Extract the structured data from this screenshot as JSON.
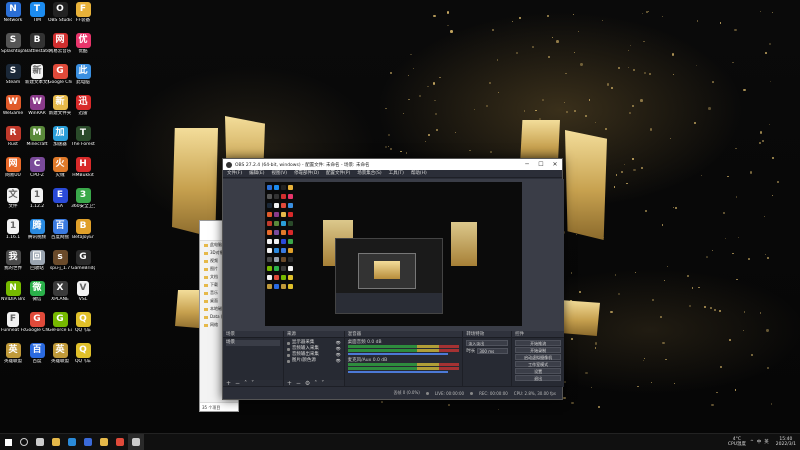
{
  "desktop": {
    "icons": [
      {
        "label": "Network",
        "icon": "network-icon",
        "color": "#2b6fd6"
      },
      {
        "label": "TIM",
        "icon": "tim-icon",
        "color": "#1c8cf0"
      },
      {
        "label": "OBS Studio",
        "icon": "obs-icon",
        "color": "#222222"
      },
      {
        "label": "FF装备",
        "icon": "ff-icon",
        "color": "#e8b23a"
      },
      {
        "label": "SplashtopStreamer",
        "icon": "splashtop-icon",
        "color": "#555555"
      },
      {
        "label": "Battlestate Games L...",
        "icon": "battlestate-icon",
        "color": "#333333"
      },
      {
        "label": "网易云音乐",
        "icon": "netease-icon",
        "color": "#d12f2f"
      },
      {
        "label": "优酷",
        "icon": "youku-icon",
        "color": "#e8356b"
      },
      {
        "label": "Steam",
        "icon": "steam-icon",
        "color": "#1b2838"
      },
      {
        "label": "新建文本文档",
        "icon": "text-file-icon",
        "color": "#f2f2f2"
      },
      {
        "label": "Google Chrome",
        "icon": "chrome-icon",
        "color": "#e04a3a"
      },
      {
        "label": "此电脑",
        "icon": "computer-icon",
        "color": "#3a8fe0"
      },
      {
        "label": "WeGame",
        "icon": "wegame-icon",
        "color": "#e05a2a"
      },
      {
        "label": "WinRAR",
        "icon": "winrar-icon",
        "color": "#8a3a8a"
      },
      {
        "label": "新建文件夹",
        "icon": "folder-icon",
        "color": "#e6b94a"
      },
      {
        "label": "迅雷",
        "icon": "thunder-icon",
        "color": "#d82a2a"
      },
      {
        "label": "Rust",
        "icon": "rust-icon",
        "color": "#c0392b"
      },
      {
        "label": "Minecraft",
        "icon": "minecraft-icon",
        "color": "#5a8a3a"
      },
      {
        "label": "加速器",
        "icon": "accelerator-icon",
        "color": "#2a9ed8"
      },
      {
        "label": "The Forest",
        "icon": "the-forest-icon",
        "color": "#2a4a2a"
      },
      {
        "label": "网易UU",
        "icon": "uu-icon",
        "color": "#e86a2a"
      },
      {
        "label": "CPU-Z",
        "icon": "cpuz-icon",
        "color": "#7a4a9a"
      },
      {
        "label": "火绒",
        "icon": "huorong-icon",
        "color": "#e07a2a"
      },
      {
        "label": "HMBukkit",
        "icon": "hmbukkit-icon",
        "color": "#d82a2a"
      },
      {
        "label": "文件",
        "icon": "file-icon",
        "color": "#f2f2f2"
      },
      {
        "label": "1.12.2",
        "icon": "version-file-icon",
        "color": "#f2f2f2"
      },
      {
        "label": "EA",
        "icon": "ea-icon",
        "color": "#2a4ad8"
      },
      {
        "label": "360安全卫士",
        "icon": "security-icon",
        "color": "#3aa84a"
      },
      {
        "label": "1.16.1",
        "icon": "version-file-icon-2",
        "color": "#f2f2f2"
      },
      {
        "label": "腾讯视频",
        "icon": "tencent-video-icon",
        "color": "#2a8ae0"
      },
      {
        "label": "百度网盘",
        "icon": "baidu-netdisk-icon",
        "color": "#3a7ae0"
      },
      {
        "label": "BetaJoyEr",
        "icon": "betajoy-icon",
        "color": "#e0a02a"
      },
      {
        "label": "我的世界",
        "icon": "mc-launcher-icon",
        "color": "#4a4a4a"
      },
      {
        "label": "回收站",
        "icon": "recycle-bin-icon",
        "color": "#9aa4b0"
      },
      {
        "label": "spu-j_1.7",
        "icon": "spu-icon",
        "color": "#6a4a2a"
      },
      {
        "label": "GameBridge",
        "icon": "gamebridge-icon",
        "color": "#2a2a2a"
      },
      {
        "label": "NVIDIA Broadcast",
        "icon": "nvidia-icon",
        "color": "#76b900"
      },
      {
        "label": "微信",
        "icon": "wechat-icon",
        "color": "#2ab04a"
      },
      {
        "label": "XPLANE",
        "icon": "xplane-icon",
        "color": "#3a3a3a"
      },
      {
        "label": "VSL",
        "icon": "vsl-icon",
        "color": "#f2f2f2"
      },
      {
        "label": "Funneat Fonts",
        "icon": "fonts-icon",
        "color": "#f2f2f2"
      },
      {
        "label": "Google Chrome",
        "icon": "chrome-icon-2",
        "color": "#e04a3a"
      },
      {
        "label": "GeForce Experience",
        "icon": "geforce-icon",
        "color": "#76b900"
      },
      {
        "label": "QQ飞车",
        "icon": "qq-speed-icon",
        "color": "#e0c02a"
      },
      {
        "label": "英雄联盟",
        "icon": "lol-icon",
        "color": "#c09a3a"
      },
      {
        "label": "百度",
        "icon": "baidu-icon",
        "color": "#2a6ae0"
      },
      {
        "label": "英雄联盟",
        "icon": "lol-icon-2",
        "color": "#c09a3a"
      },
      {
        "label": "QQ飞车",
        "icon": "qq-speed-icon-2",
        "color": "#e0c02a"
      }
    ]
  },
  "obs": {
    "title": "OBS 27.2.4 (64-bit, windows) - 配置文件: 未命名 - 场景: 未命名",
    "menu": [
      "文件(F)",
      "编辑(E)",
      "视图(V)",
      "停靠部件(D)",
      "配置文件(P)",
      "场景集合(S)",
      "工具(T)",
      "帮助(H)"
    ],
    "docks": {
      "scenes": {
        "title": "场景",
        "items": [
          "场景"
        ]
      },
      "sources": {
        "title": "来源",
        "items": [
          "显示器采集",
          "音频输入采集",
          "音频输出采集",
          "图片/颜色源"
        ]
      },
      "mixer": {
        "title": "混音器",
        "channels": [
          {
            "name": "桌面音频",
            "db": "0.0 dB"
          },
          {
            "name": "麦克风/Aux",
            "db": "0.0 dB"
          }
        ]
      },
      "transitions": {
        "title": "转场特效",
        "type": "淡入淡出",
        "duration_label": "时长",
        "duration": "300 ms"
      },
      "controls": {
        "title": "控件",
        "buttons": [
          "开始推流",
          "开始录制",
          "启动虚拟摄像机",
          "工作室模式",
          "设置",
          "退出"
        ]
      }
    },
    "status": {
      "dropped": "丢帧 0 (0.0%)",
      "live": "LIVE: 00:00:00",
      "rec": "REC: 00:00:00",
      "cpu": "CPU: 2.8%, 30.00 fps"
    }
  },
  "explorer": {
    "items": [
      "此电脑",
      "3D对象",
      "视频",
      "图片",
      "文档",
      "下载",
      "音乐",
      "桌面",
      "本地磁盘 (C:)",
      "Data (D:)",
      "网络"
    ],
    "status": "35 个项目"
  },
  "taskbar": {
    "items": [
      {
        "icon": "windows-start-icon",
        "color": "#ffffff"
      },
      {
        "icon": "search-icon",
        "color": "#cccccc"
      },
      {
        "icon": "task-view-icon",
        "color": "#cccccc"
      },
      {
        "icon": "file-explorer-icon",
        "color": "#e6b94a"
      },
      {
        "icon": "edge-icon",
        "color": "#2a8ad8"
      },
      {
        "icon": "store-icon",
        "color": "#3a6ad8"
      },
      {
        "icon": "folder-taskbar-icon",
        "color": "#e6b94a"
      },
      {
        "icon": "chrome-taskbar-icon",
        "color": "#e04a3a"
      },
      {
        "icon": "obs-taskbar-icon",
        "color": "#cccccc"
      }
    ],
    "weather": {
      "temp": "4°C",
      "desc": "CPU温度"
    },
    "tray_labels": [
      "^",
      "中",
      "英"
    ],
    "clock": {
      "time": "15:40",
      "date": "2022/3/1"
    }
  }
}
